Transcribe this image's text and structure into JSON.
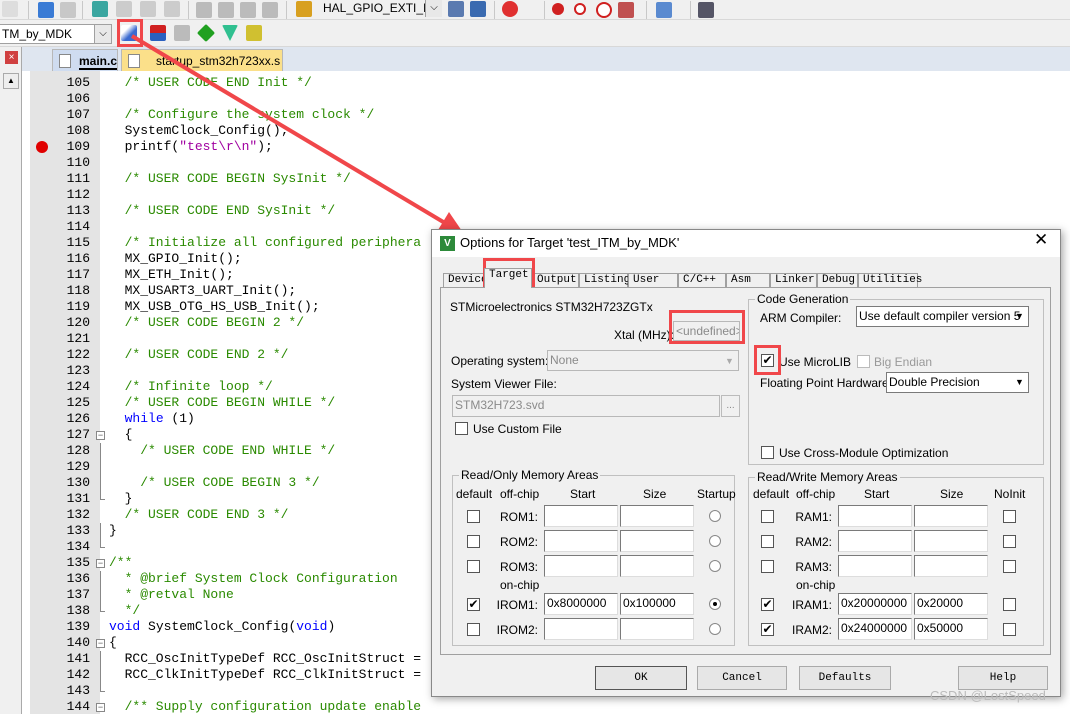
{
  "toolbar": {
    "function_combo": "HAL_GPIO_EXTI_IRQHand",
    "target_combo": "TM_by_MDK"
  },
  "file_tabs": [
    {
      "label": "main.c",
      "active": true
    },
    {
      "label": "startup_stm32h723xx.s",
      "active": false
    }
  ],
  "editor": {
    "breakpoint_line": 109,
    "lines": [
      {
        "n": 105,
        "t": [
          [
            "  /* USER CODE END Init */",
            "comment"
          ]
        ]
      },
      {
        "n": 106,
        "t": []
      },
      {
        "n": 107,
        "t": [
          [
            "  /* Configure the system clock */",
            "comment"
          ]
        ]
      },
      {
        "n": 108,
        "t": [
          [
            "  SystemClock_Config();",
            "code"
          ]
        ]
      },
      {
        "n": 109,
        "t": [
          [
            "  printf(",
            "code"
          ],
          [
            "\"test\\r\\n\"",
            "str"
          ],
          [
            ");",
            "code"
          ]
        ]
      },
      {
        "n": 110,
        "t": []
      },
      {
        "n": 111,
        "t": [
          [
            "  /* USER CODE BEGIN SysInit */",
            "comment"
          ]
        ]
      },
      {
        "n": 112,
        "t": []
      },
      {
        "n": 113,
        "t": [
          [
            "  /* USER CODE END SysInit */",
            "comment"
          ]
        ]
      },
      {
        "n": 114,
        "t": []
      },
      {
        "n": 115,
        "t": [
          [
            "  /* Initialize all configured periphera",
            "comment"
          ]
        ]
      },
      {
        "n": 116,
        "t": [
          [
            "  MX_GPIO_Init();",
            "code"
          ]
        ]
      },
      {
        "n": 117,
        "t": [
          [
            "  MX_ETH_Init();",
            "code"
          ]
        ]
      },
      {
        "n": 118,
        "t": [
          [
            "  MX_USART3_UART_Init();",
            "code"
          ]
        ]
      },
      {
        "n": 119,
        "t": [
          [
            "  MX_USB_OTG_HS_USB_Init();",
            "code"
          ]
        ]
      },
      {
        "n": 120,
        "t": [
          [
            "  /* USER CODE BEGIN 2 */",
            "comment"
          ]
        ]
      },
      {
        "n": 121,
        "t": []
      },
      {
        "n": 122,
        "t": [
          [
            "  /* USER CODE END 2 */",
            "comment"
          ]
        ]
      },
      {
        "n": 123,
        "t": []
      },
      {
        "n": 124,
        "t": [
          [
            "  /* Infinite loop */",
            "comment"
          ]
        ]
      },
      {
        "n": 125,
        "t": [
          [
            "  /* USER CODE BEGIN WHILE */",
            "comment"
          ]
        ]
      },
      {
        "n": 126,
        "t": [
          [
            "  ",
            "code"
          ],
          [
            "while",
            "kw"
          ],
          [
            " (1)",
            "code"
          ]
        ]
      },
      {
        "n": 127,
        "t": [
          [
            "  {",
            "code"
          ]
        ]
      },
      {
        "n": 128,
        "t": [
          [
            "    /* USER CODE END WHILE */",
            "comment"
          ]
        ]
      },
      {
        "n": 129,
        "t": []
      },
      {
        "n": 130,
        "t": [
          [
            "    /* USER CODE BEGIN 3 */",
            "comment"
          ]
        ]
      },
      {
        "n": 131,
        "t": [
          [
            "  }",
            "code"
          ]
        ]
      },
      {
        "n": 132,
        "t": [
          [
            "  /* USER CODE END 3 */",
            "comment"
          ]
        ]
      },
      {
        "n": 133,
        "t": [
          [
            "}",
            "code"
          ]
        ]
      },
      {
        "n": 134,
        "t": []
      },
      {
        "n": 135,
        "t": [
          [
            "/**",
            "comment"
          ]
        ]
      },
      {
        "n": 136,
        "t": [
          [
            "  * @brief System Clock Configuration",
            "comment"
          ]
        ]
      },
      {
        "n": 137,
        "t": [
          [
            "  * @retval None",
            "comment"
          ]
        ]
      },
      {
        "n": 138,
        "t": [
          [
            "  */",
            "comment"
          ]
        ]
      },
      {
        "n": 139,
        "t": [
          [
            "void",
            "kw"
          ],
          [
            " SystemClock_Config(",
            "code"
          ],
          [
            "void",
            "kw"
          ],
          [
            ")",
            "code"
          ]
        ]
      },
      {
        "n": 140,
        "t": [
          [
            "{",
            "code"
          ]
        ]
      },
      {
        "n": 141,
        "t": [
          [
            "  RCC_OscInitTypeDef RCC_OscInitStruct =",
            "code"
          ]
        ]
      },
      {
        "n": 142,
        "t": [
          [
            "  RCC_ClkInitTypeDef RCC_ClkInitStruct =",
            "code"
          ]
        ]
      },
      {
        "n": 143,
        "t": []
      },
      {
        "n": 144,
        "t": [
          [
            "  /** Supply configuration update enable",
            "comment"
          ]
        ]
      }
    ]
  },
  "dialog": {
    "title": "Options for Target 'test_ITM_by_MDK'",
    "tabs": [
      "Device",
      "Target",
      "Output",
      "Listing",
      "User",
      "C/C++",
      "Asm",
      "Linker",
      "Debug",
      "Utilities"
    ],
    "active_tab": "Target",
    "device": "STMicroelectronics STM32H723ZGTx",
    "xtal_label": "Xtal (MHz):",
    "xtal_value": "<undefined>",
    "os_label": "Operating system:",
    "os_value": "None",
    "svf_label": "System Viewer File:",
    "svf_value": "STM32H723.svd",
    "browse": "...",
    "custom_file": "Use Custom File",
    "code_gen": {
      "title": "Code Generation",
      "compiler_label": "ARM Compiler:",
      "compiler_value": "Use default compiler version 5",
      "microlib": "Use MicroLIB",
      "microlib_checked": true,
      "big_endian": "Big Endian",
      "fpu_label": "Floating Point Hardware:",
      "fpu_value": "Double Precision",
      "cross_module": "Use Cross-Module Optimization"
    },
    "ro": {
      "title": "Read/Only Memory Areas",
      "headers": [
        "default",
        "off-chip",
        "Start",
        "Size",
        "Startup"
      ],
      "onchip": "on-chip",
      "rows": [
        {
          "label": "ROM1:",
          "default": false,
          "start": "",
          "size": "",
          "startup": false
        },
        {
          "label": "ROM2:",
          "default": false,
          "start": "",
          "size": "",
          "startup": false
        },
        {
          "label": "ROM3:",
          "default": false,
          "start": "",
          "size": "",
          "startup": false
        },
        {
          "label": "IROM1:",
          "default": true,
          "start": "0x8000000",
          "size": "0x100000",
          "startup": true
        },
        {
          "label": "IROM2:",
          "default": false,
          "start": "",
          "size": "",
          "startup": false
        }
      ]
    },
    "rw": {
      "title": "Read/Write Memory Areas",
      "headers": [
        "default",
        "off-chip",
        "Start",
        "Size",
        "NoInit"
      ],
      "onchip": "on-chip",
      "rows": [
        {
          "label": "RAM1:",
          "default": false,
          "start": "",
          "size": "",
          "noinit": false
        },
        {
          "label": "RAM2:",
          "default": false,
          "start": "",
          "size": "",
          "noinit": false
        },
        {
          "label": "RAM3:",
          "default": false,
          "start": "",
          "size": "",
          "noinit": false
        },
        {
          "label": "IRAM1:",
          "default": true,
          "start": "0x20000000",
          "size": "0x20000",
          "noinit": false
        },
        {
          "label": "IRAM2:",
          "default": true,
          "start": "0x24000000",
          "size": "0x50000",
          "noinit": false
        }
      ]
    },
    "buttons": {
      "ok": "OK",
      "cancel": "Cancel",
      "defaults": "Defaults",
      "help": "Help"
    }
  },
  "watermark": "CSDN @LostSpeed",
  "colors": {
    "highlight": "#f0474a",
    "comment": "#2a8a00",
    "keyword": "#0000ff",
    "string": "#a000a0"
  }
}
